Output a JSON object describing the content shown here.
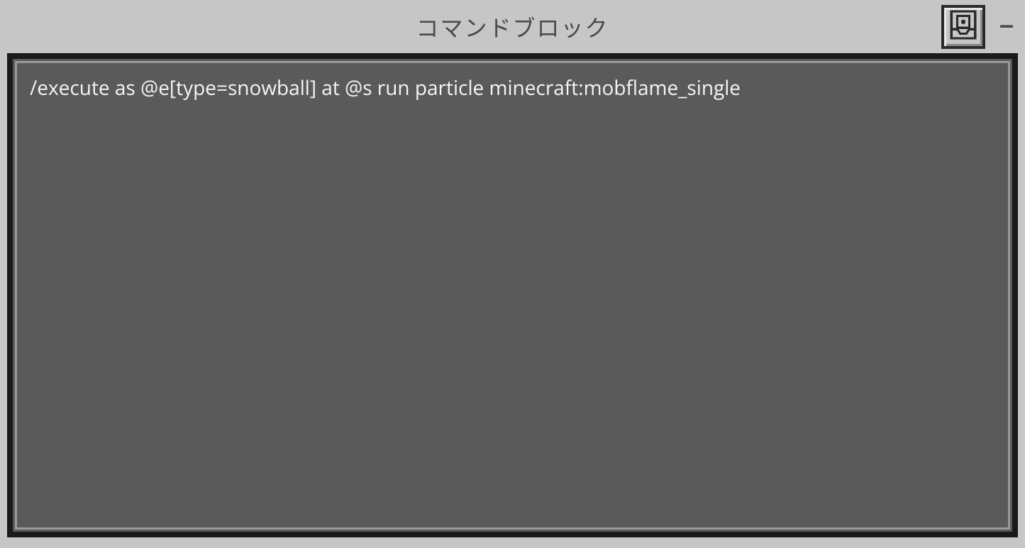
{
  "header": {
    "title": "コマンドブロック",
    "minimize_label": "–"
  },
  "command": {
    "value": "/execute as @e[type=snowball] at @s run particle minecraft:mobflame_single"
  }
}
